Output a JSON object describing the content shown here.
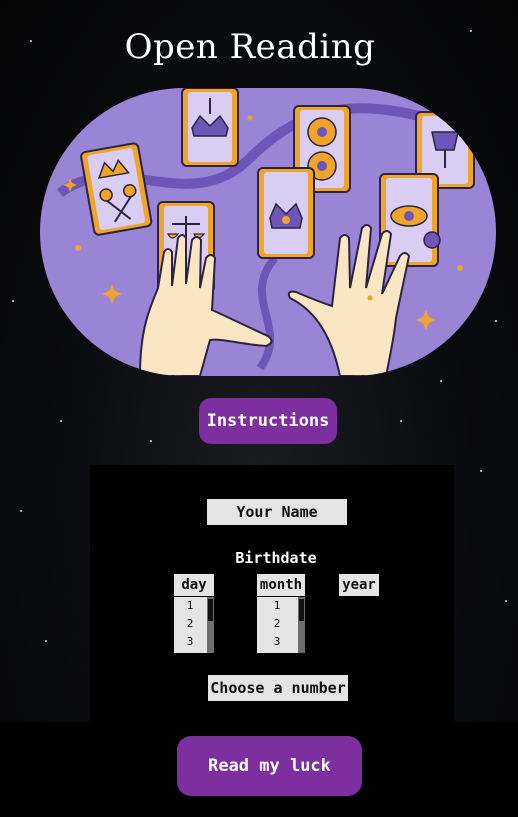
{
  "title": "Open Reading",
  "instructions_label": "Instructions",
  "form": {
    "name_placeholder": "Your Name",
    "birthdate_label": "Birthdate",
    "day": {
      "label": "day",
      "options": [
        "1",
        "2",
        "3"
      ]
    },
    "month": {
      "label": "month",
      "options": [
        "1",
        "2",
        "3"
      ]
    },
    "year": {
      "label": "year"
    },
    "number_placeholder": "Choose a number",
    "submit_label": "Read my luck"
  },
  "colors": {
    "accent": "#7d2e9f",
    "background": "#07080b",
    "illustration_purple": "#9a84d6"
  },
  "illustration": {
    "description_icon": "tarot-cards-illustration"
  }
}
